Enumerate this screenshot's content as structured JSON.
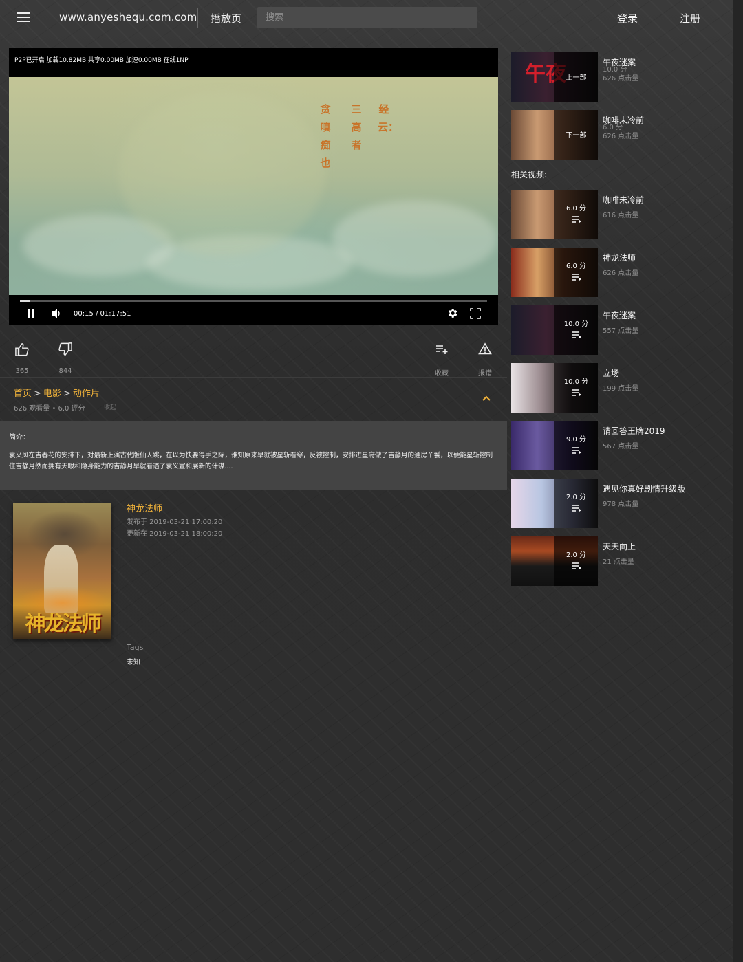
{
  "header": {
    "site_title": "www.anyeshequ.com.com",
    "nav_play": "播放页",
    "search_placeholder": "搜索",
    "login": "登录",
    "register": "注册"
  },
  "player": {
    "p2p_status": "P2P已开启 加载10.82MB 共享0.00MB 加速0.00MB 在线1NP",
    "time": "00:15 / 01:17:51",
    "progress": 0.02,
    "calligraphy": [
      "经云：",
      "三高者",
      "贪嗔痴也"
    ]
  },
  "actions": {
    "like_count": "365",
    "dislike_count": "844",
    "favorite_label": "收藏",
    "report_label": "报错"
  },
  "info": {
    "breadcrumb": [
      "首页",
      "电影",
      "动作片"
    ],
    "breadcrumb_sep": ">",
    "meta": "626 观看量 • 6.0 评分",
    "fav": "收起"
  },
  "summary": {
    "title": "简介：",
    "text": "袁义风在吉春花的安排下，对最新上演古代版仙人跳，在以为快要得手之际，谁知原来早就被星斩看穿，反被控制，安排进星府做了吉静月的通房丫鬟，以便能星斩控制住吉静月然而拥有天眼和隐身能力的吉静月早就看透了袁义宣和展新的计谋...."
  },
  "detail": {
    "name": "神龙法师",
    "published": "发布于 2019-03-21 17:00:20",
    "updated": "更新在 2019-03-21 18:00:20",
    "tags_label": "Tags",
    "tags_value": "未知",
    "poster_text": "神龙法师"
  },
  "sidebar": {
    "prev": {
      "label": "上一部",
      "title": "午夜迷案",
      "score": "10.0 分",
      "views": "626 点击量"
    },
    "next": {
      "label": "下一部",
      "title": "咖啡未冷前",
      "score": "6.0 分",
      "views": "626 点击量"
    },
    "related_heading": "相关视频:",
    "related": [
      {
        "title": "咖啡未冷前",
        "score": "6.0 分",
        "views": "616 点击量"
      },
      {
        "title": "神龙法师",
        "score": "6.0 分",
        "views": "626 点击量"
      },
      {
        "title": "午夜迷案",
        "score": "10.0 分",
        "views": "557 点击量"
      },
      {
        "title": "立场",
        "score": "10.0 分",
        "views": "199 点击量"
      },
      {
        "title": "请回答王牌2019",
        "score": "9.0 分",
        "views": "567 点击量"
      },
      {
        "title": "遇见你真好剧情升级版",
        "score": "2.0 分",
        "views": "978 点击量"
      },
      {
        "title": "天天向上",
        "score": "2.0 分",
        "views": "21 点击量"
      }
    ]
  },
  "colors": {
    "accent": "#f0b23a",
    "background": "#2e2e2e",
    "summary_bg": "#444444"
  }
}
